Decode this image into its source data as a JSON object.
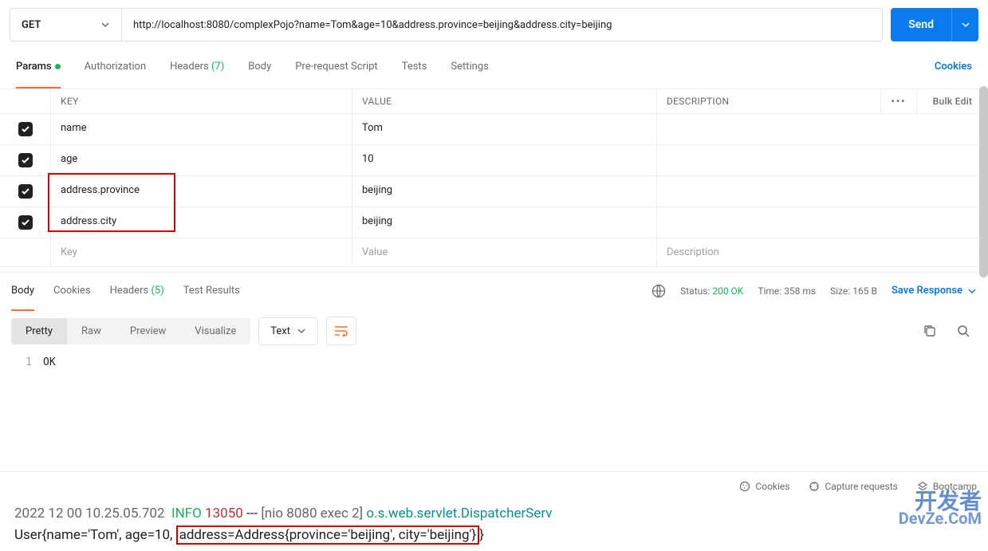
{
  "request": {
    "method": "GET",
    "url": "http://localhost:8080/complexPojo?name=Tom&age=10&address.province=beijing&address.city=beijing",
    "send_label": "Send"
  },
  "tabs": {
    "params": "Params",
    "authorization": "Authorization",
    "headers": "Headers",
    "headers_count": "(7)",
    "body": "Body",
    "prerequest": "Pre-request Script",
    "tests": "Tests",
    "settings": "Settings",
    "cookies": "Cookies"
  },
  "params_table": {
    "header_key": "KEY",
    "header_value": "VALUE",
    "header_desc": "DESCRIPTION",
    "bulk_edit": "Bulk Edit",
    "rows": [
      {
        "key": "name",
        "value": "Tom",
        "desc": ""
      },
      {
        "key": "age",
        "value": "10",
        "desc": ""
      },
      {
        "key": "address.province",
        "value": "beijing",
        "desc": ""
      },
      {
        "key": "address.city",
        "value": "beijing",
        "desc": ""
      }
    ],
    "placeholder_key": "Key",
    "placeholder_value": "Value",
    "placeholder_desc": "Description"
  },
  "response_tabs": {
    "body": "Body",
    "cookies": "Cookies",
    "headers": "Headers",
    "headers_count": "(5)",
    "tests": "Test Results"
  },
  "response_status": {
    "status_label": "Status:",
    "status_value": "200 OK",
    "time_label": "Time:",
    "time_value": "358 ms",
    "size_label": "Size:",
    "size_value": "165 B",
    "save": "Save Response"
  },
  "view": {
    "pretty": "Pretty",
    "raw": "Raw",
    "preview": "Preview",
    "visualize": "Visualize",
    "format": "Text"
  },
  "response_body": {
    "line1_num": "1",
    "line1": "OK"
  },
  "bottom": {
    "cookies": "Cookies",
    "capture": "Capture requests",
    "bootcamp": "Bootcamp"
  },
  "console": {
    "line1_ts": "2022 12 00 10.25.05.702",
    "line1_info": "INFO",
    "line1_pid": "13050",
    "line1_mid": "[nio 8080 exec 2]",
    "line1_tail": "o.s.web.servlet.DispatcherServ",
    "line2_prefix": "User{name='Tom', age=10, ",
    "line2_box": "address=Address{province='beijing', city='beijing'}",
    "line2_suffix": "}"
  },
  "watermark": {
    "l1": "开发者",
    "l2": "DevZe.CoM"
  }
}
